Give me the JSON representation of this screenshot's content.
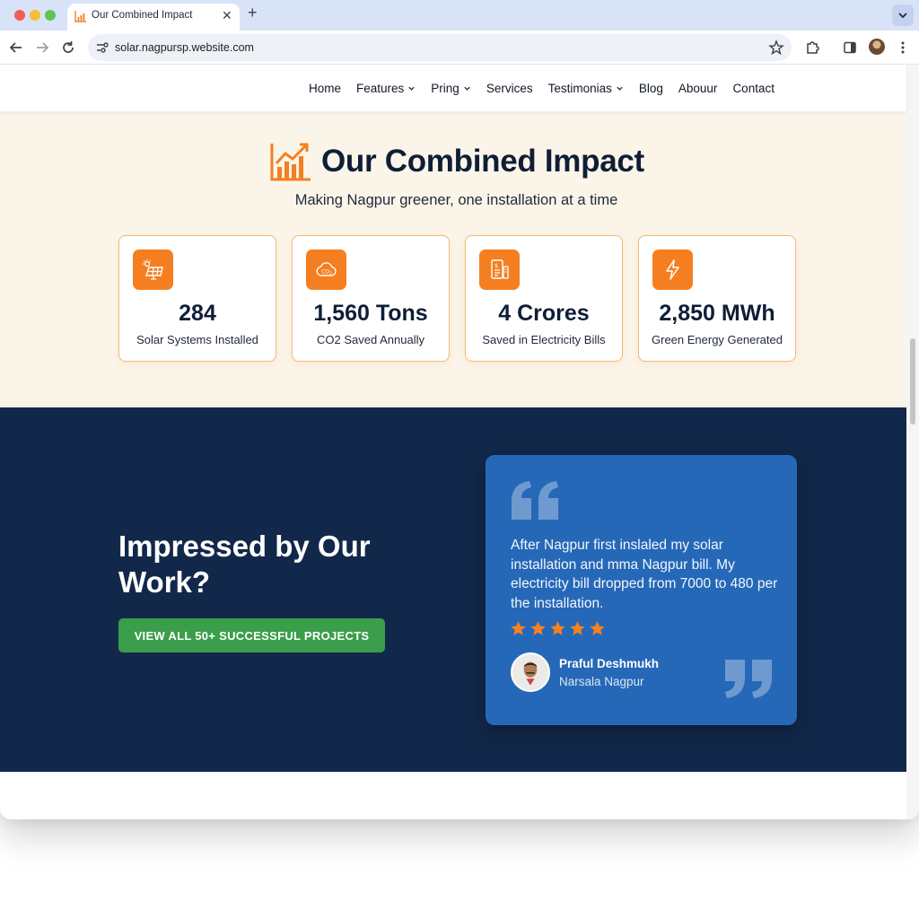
{
  "browser": {
    "tab_title": "Our Combined Impact",
    "tab_close": "✕",
    "new_tab": "+",
    "url": "solar.nagpursp.website.com"
  },
  "nav": {
    "items": [
      {
        "label": "Home",
        "dropdown": false
      },
      {
        "label": "Features",
        "dropdown": true
      },
      {
        "label": "Pring",
        "dropdown": true
      },
      {
        "label": "Services",
        "dropdown": false
      },
      {
        "label": "Testimonias",
        "dropdown": true
      },
      {
        "label": "Blog",
        "dropdown": false
      },
      {
        "label": "Abouur",
        "dropdown": false
      },
      {
        "label": "Contact",
        "dropdown": false
      }
    ]
  },
  "impact": {
    "title": "Our Combined Impact",
    "subtitle": "Making Nagpur greener, one installation at a time",
    "stats": [
      {
        "icon": "solar-panel-icon",
        "value": "284",
        "label": "Solar Systems Installed"
      },
      {
        "icon": "co2-cloud-icon",
        "value": "1,560 Tons",
        "label": "CO2 Saved Annually"
      },
      {
        "icon": "bill-document-icon",
        "value": "4 Crores",
        "label": "Saved in Electricity Bills"
      },
      {
        "icon": "lightning-bolt-icon",
        "value": "2,850 MWh",
        "label": "Green Energy Generated"
      }
    ]
  },
  "cta": {
    "title": "Impressed by Our Work?",
    "button_label": "VIEW ALL 50+ SUCCESSFUL PROJECTS"
  },
  "testimonial": {
    "quote": "After Nagpur first inslaled my solar installation and mma Nagpur bill. My electricity bill dropped from 7000 to 480 per the installation.",
    "rating": 5,
    "name": "Praful Deshmukh",
    "location": "Narsala Nagpur"
  },
  "colors": {
    "accent_orange": "#f57f20",
    "navy": "#12284a",
    "card_blue": "#2668b8",
    "cta_green": "#3a9e4a",
    "cream": "#fbf5e9"
  }
}
